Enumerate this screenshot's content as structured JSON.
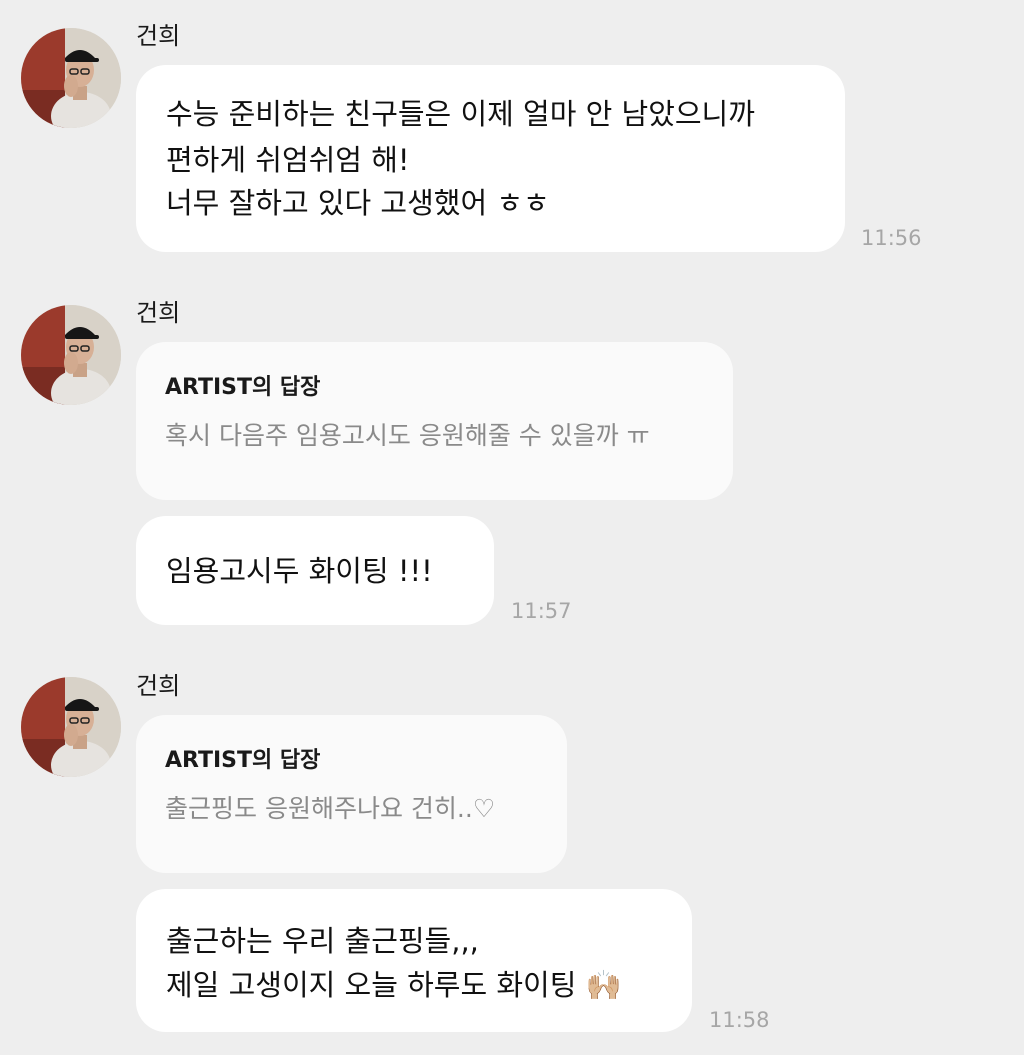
{
  "messages": [
    {
      "sender": "건희",
      "text_lines": [
        "수능 준비하는 친구들은 이제 얼마 안 남았으니까",
        "편하게 쉬엄쉬엄 해!",
        "너무 잘하고 있다 고생했어 ㅎㅎ"
      ],
      "time": "11:56"
    },
    {
      "sender": "건희",
      "reply_title": "ARTIST의 답장",
      "reply_quote": "혹시 다음주 임용고시도 응원해줄 수 있을까 ㅠ",
      "text_lines": [
        "임용고시두 화이팅 !!!"
      ],
      "time": "11:57"
    },
    {
      "sender": "건희",
      "reply_title": "ARTIST의 답장",
      "reply_quote": "출근핑도 응원해주나요 건히..♡",
      "text_lines": [
        "출근하는 우리 출근핑들,,,",
        "제일 고생이지 오늘 하루도 화이팅 🙌🏼"
      ],
      "time": "11:58"
    }
  ],
  "colors": {
    "background": "#eeeeee",
    "bubble": "#ffffff",
    "reply_bubble": "#fafafa",
    "quote_text": "#8a8a8a",
    "time_text": "#a6a6a6"
  },
  "icons": {
    "avatar": "profile-photo"
  }
}
